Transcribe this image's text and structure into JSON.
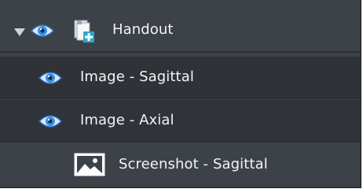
{
  "tree": {
    "items": [
      {
        "label": "Handout",
        "visibility_icon": "eye-icon",
        "type_icon": "document-add-icon",
        "expanded": true
      },
      {
        "label": "Image - Sagittal",
        "visibility_icon": "eye-icon"
      },
      {
        "label": "Image - Axial",
        "visibility_icon": "eye-icon"
      },
      {
        "label": "Screenshot - Sagittal",
        "type_icon": "image-icon"
      }
    ]
  },
  "colors": {
    "panel_bg": "#3d4248",
    "row_alt_bg": "#2f3338",
    "text": "#f2f3f5",
    "eye_blue": "#3a8fe0"
  }
}
